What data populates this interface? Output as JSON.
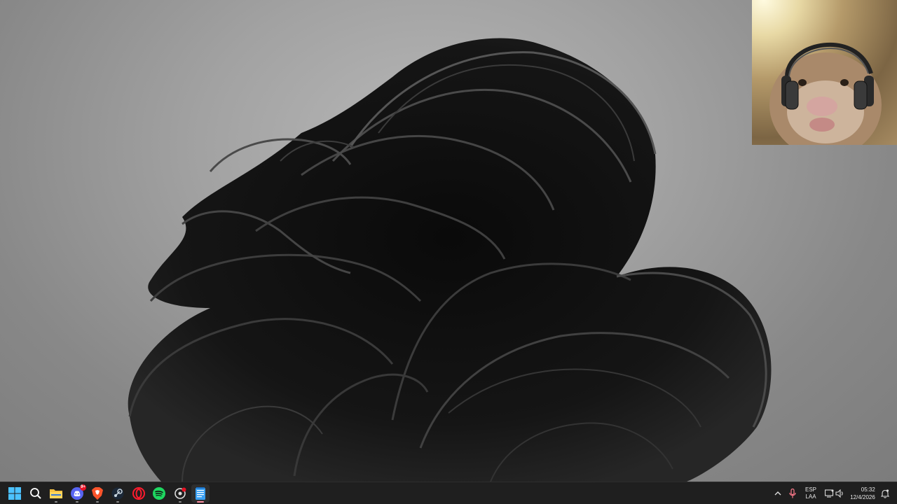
{
  "taskbar": {
    "apps": [
      {
        "name": "Start",
        "icon": "windows-start-icon"
      },
      {
        "name": "Search",
        "icon": "search-icon"
      },
      {
        "name": "File Explorer",
        "icon": "folder-icon"
      },
      {
        "name": "Discord",
        "icon": "discord-icon",
        "badge": "9+"
      },
      {
        "name": "Brave",
        "icon": "brave-icon"
      },
      {
        "name": "Steam",
        "icon": "steam-icon"
      },
      {
        "name": "Opera GX",
        "icon": "opera-icon"
      },
      {
        "name": "Spotify",
        "icon": "spotify-icon"
      },
      {
        "name": "Lens",
        "icon": "lens-icon"
      },
      {
        "name": "Notepad",
        "icon": "notepad-icon"
      }
    ],
    "tray": {
      "language_line1": "ESP",
      "language_line2": "LAA",
      "time": "05:32",
      "date": "12/4/2026"
    }
  },
  "colors": {
    "taskbar_bg": "#1f1f1f",
    "accent": "#ff8fa3",
    "badge": "#e81123"
  }
}
